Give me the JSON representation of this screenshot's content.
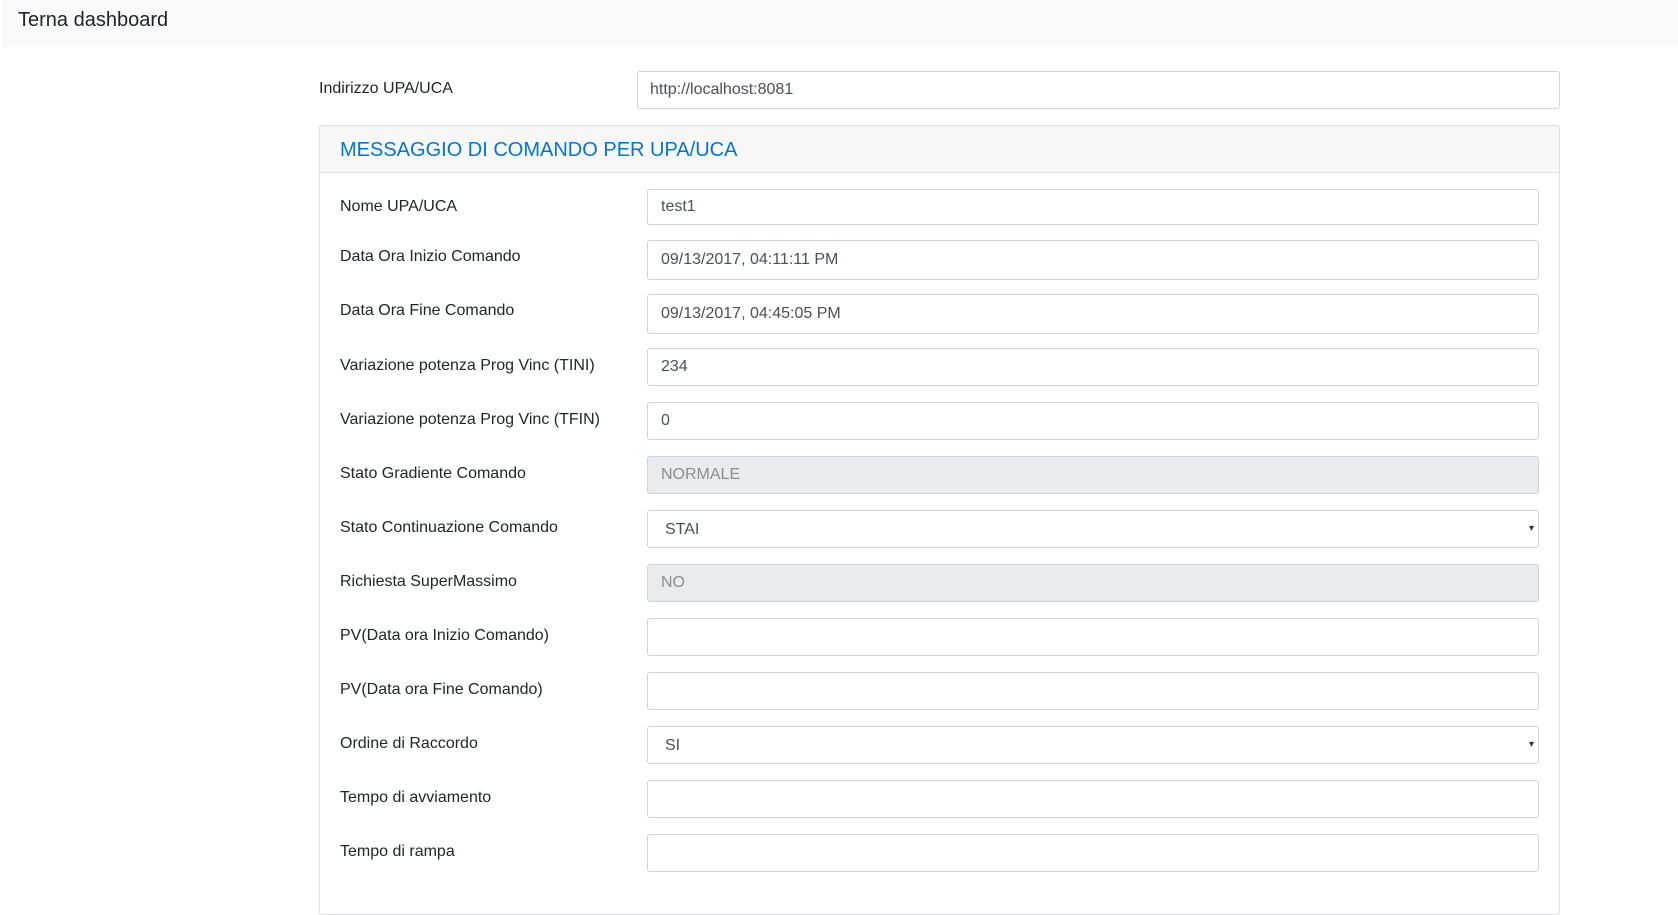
{
  "navbar": {
    "brand": "Terna dashboard"
  },
  "address": {
    "label": "Indirizzo UPA/UCA",
    "value": "http://localhost:8081"
  },
  "card": {
    "title": "MESSAGGIO DI COMANDO PER UPA/UCA",
    "fields": {
      "nome": {
        "label": "Nome UPA/UCA",
        "value": "test1"
      },
      "inizio": {
        "label": "Data Ora Inizio Comando",
        "value": "09/13/2017, 04:11:11 PM"
      },
      "fine": {
        "label": "Data Ora Fine Comando",
        "value": "09/13/2017, 04:45:05 PM"
      },
      "tini": {
        "label": "Variazione potenza Prog Vinc (TINI)",
        "value": "234"
      },
      "tfin": {
        "label": "Variazione potenza Prog Vinc (TFIN)",
        "value": "0"
      },
      "gradiente": {
        "label": "Stato Gradiente Comando",
        "value": "NORMALE"
      },
      "continuazione": {
        "label": "Stato Continuazione Comando",
        "selected": "STAI"
      },
      "supermassimo": {
        "label": "Richiesta SuperMassimo",
        "value": "NO"
      },
      "pv_inizio": {
        "label": "PV(Data ora Inizio Comando)",
        "value": ""
      },
      "pv_fine": {
        "label": "PV(Data ora Fine Comando)",
        "value": ""
      },
      "raccordo": {
        "label": "Ordine di Raccordo",
        "selected": "SI"
      },
      "avviamento": {
        "label": "Tempo di avviamento",
        "value": ""
      },
      "rampa": {
        "label": "Tempo di rampa",
        "value": ""
      }
    }
  },
  "icons": {
    "select_caret": "chevron-down-icon"
  }
}
